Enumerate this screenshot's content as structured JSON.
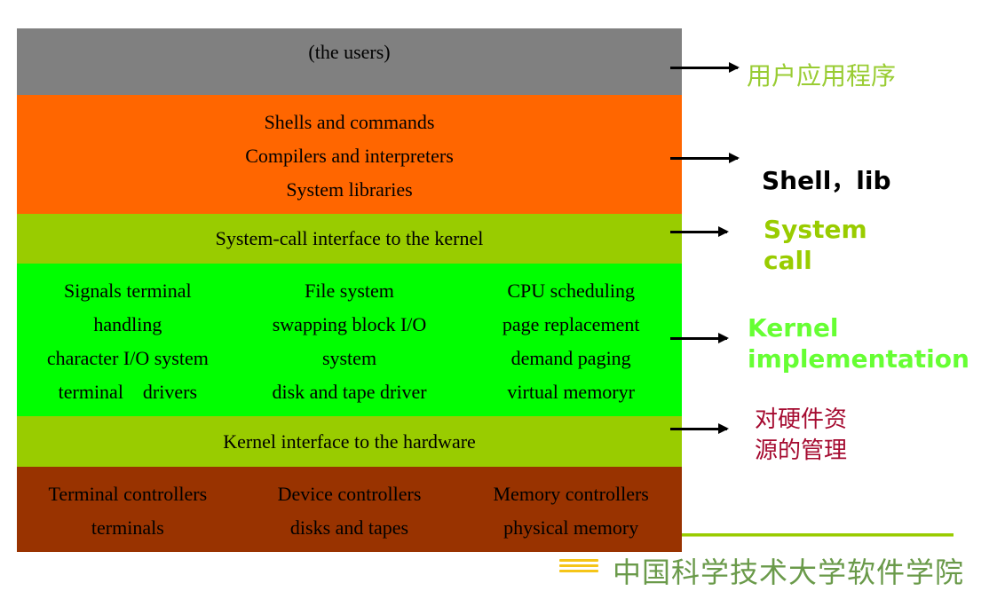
{
  "layers": {
    "users": {
      "lines": [
        "(the users)"
      ],
      "color": "#808080"
    },
    "shells": {
      "lines": [
        "Shells and commands",
        "Compilers and interpreters",
        "System libraries"
      ],
      "color": "#ff6600"
    },
    "syscall": {
      "lines": [
        "System-call interface to the kernel"
      ],
      "color": "#99cc00"
    },
    "kernel": {
      "color": "#00ff00",
      "columns": [
        [
          "Signals terminal",
          "handling",
          "character I/O system",
          "terminal    drivers"
        ],
        [
          "File system",
          "swapping block I/O",
          "system",
          "disk and tape driver"
        ],
        [
          "CPU scheduling",
          "page replacement",
          "demand paging",
          "virtual memoryr"
        ]
      ]
    },
    "hw_interface": {
      "lines": [
        "Kernel interface to the hardware"
      ],
      "color": "#99cc00"
    },
    "hardware": {
      "color": "#993300",
      "columns": [
        [
          "Terminal controllers",
          "terminals"
        ],
        [
          "Device controllers",
          "disks and tapes"
        ],
        [
          "Memory controllers",
          "physical memory"
        ]
      ]
    }
  },
  "annotations": {
    "user_apps": {
      "text": "用户应用程序",
      "color": "#99cc33"
    },
    "shell_lib": {
      "text": "Shell，lib",
      "color": "#000000"
    },
    "system_call": {
      "lines": [
        "System",
        "call"
      ],
      "color": "#99cc00"
    },
    "kernel_impl": {
      "lines": [
        "Kernel",
        "implementation"
      ],
      "color": "#66ff33"
    },
    "hw_mgmt": {
      "lines": [
        "对硬件资",
        "源的管理"
      ],
      "color": "#a50b30"
    }
  },
  "footer": {
    "title": "中国科学技术大学软件学院"
  }
}
